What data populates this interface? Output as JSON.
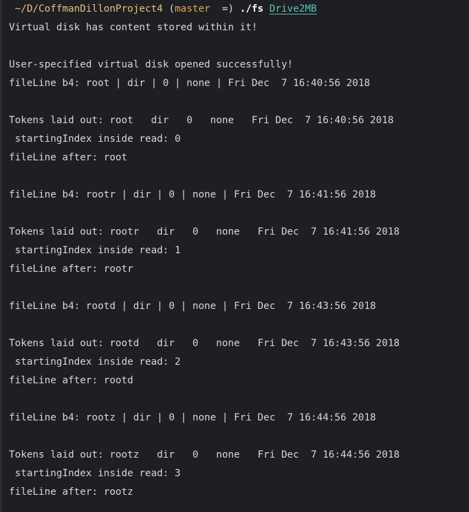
{
  "prompt": {
    "path": " ~/D/CoffmanDillonProject4",
    "git_open": " (",
    "branch": "master",
    "git_status": "  =) ",
    "command": "./fs",
    "argument": "Drive2MB"
  },
  "output_lines": [
    "Virtual disk has content stored within it!",
    "",
    "User-specified virtual disk opened successfully!",
    "fileLine b4: root | dir | 0 | none | Fri Dec  7 16:40:56 2018",
    "",
    "Tokens laid out: root   dir   0   none   Fri Dec  7 16:40:56 2018",
    " startingIndex inside read: 0",
    "fileLine after: root",
    "",
    "fileLine b4: rootr | dir | 0 | none | Fri Dec  7 16:41:56 2018",
    "",
    "Tokens laid out: rootr   dir   0   none   Fri Dec  7 16:41:56 2018",
    " startingIndex inside read: 1",
    "fileLine after: rootr",
    "",
    "fileLine b4: rootd | dir | 0 | none | Fri Dec  7 16:43:56 2018",
    "",
    "Tokens laid out: rootd   dir   0   none   Fri Dec  7 16:43:56 2018",
    " startingIndex inside read: 2",
    "fileLine after: rootd",
    "",
    "fileLine b4: rootz | dir | 0 | none | Fri Dec  7 16:44:56 2018",
    "",
    "Tokens laid out: rootz   dir   0   none   Fri Dec  7 16:44:56 2018",
    " startingIndex inside read: 3",
    "fileLine after: rootz"
  ],
  "colors": {
    "background": "#1e1f22",
    "text": "#d4d7dc",
    "path": "#e3c27a",
    "branch": "#e0a84a",
    "argument": "#58c3b4"
  }
}
